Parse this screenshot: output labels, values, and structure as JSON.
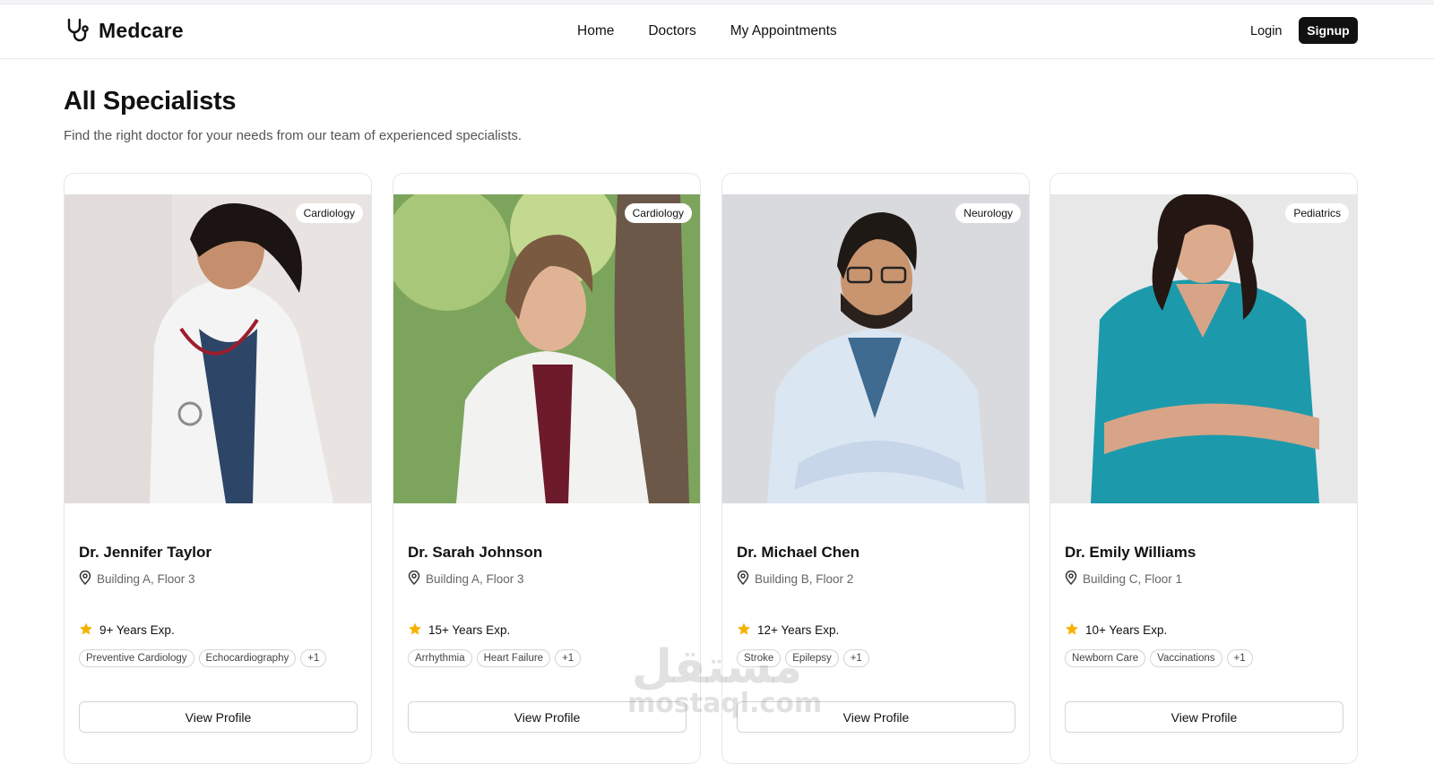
{
  "brand": {
    "name": "Medcare",
    "icon": "stethoscope-icon"
  },
  "nav": {
    "links": [
      "Home",
      "Doctors",
      "My Appointments"
    ]
  },
  "auth": {
    "login": "Login",
    "signup": "Signup"
  },
  "page": {
    "title": "All Specialists",
    "subtitle": "Find the right doctor for your needs from our team of experienced specialists."
  },
  "cards": [
    {
      "specialty": "Cardiology",
      "name": "Dr. Jennifer Taylor",
      "location": "Building A, Floor 3",
      "experience": "9+ Years Exp.",
      "tags": [
        "Preventive Cardiology",
        "Echocardiography",
        "+1"
      ],
      "button": "View Profile"
    },
    {
      "specialty": "Cardiology",
      "name": "Dr. Sarah Johnson",
      "location": "Building A, Floor 3",
      "experience": "15+ Years Exp.",
      "tags": [
        "Arrhythmia",
        "Heart Failure",
        "+1"
      ],
      "button": "View Profile"
    },
    {
      "specialty": "Neurology",
      "name": "Dr. Michael Chen",
      "location": "Building B, Floor 2",
      "experience": "12+ Years Exp.",
      "tags": [
        "Stroke",
        "Epilepsy",
        "+1"
      ],
      "button": "View Profile"
    },
    {
      "specialty": "Pediatrics",
      "name": "Dr. Emily Williams",
      "location": "Building C, Floor 1",
      "experience": "10+ Years Exp.",
      "tags": [
        "Newborn Care",
        "Vaccinations",
        "+1"
      ],
      "button": "View Profile"
    }
  ],
  "watermark": {
    "arabic": "مستقل",
    "latin": "mostaql.com"
  },
  "colors": {
    "accent": "#111111",
    "star": "#f5b301",
    "border": "#e5e7eb"
  }
}
